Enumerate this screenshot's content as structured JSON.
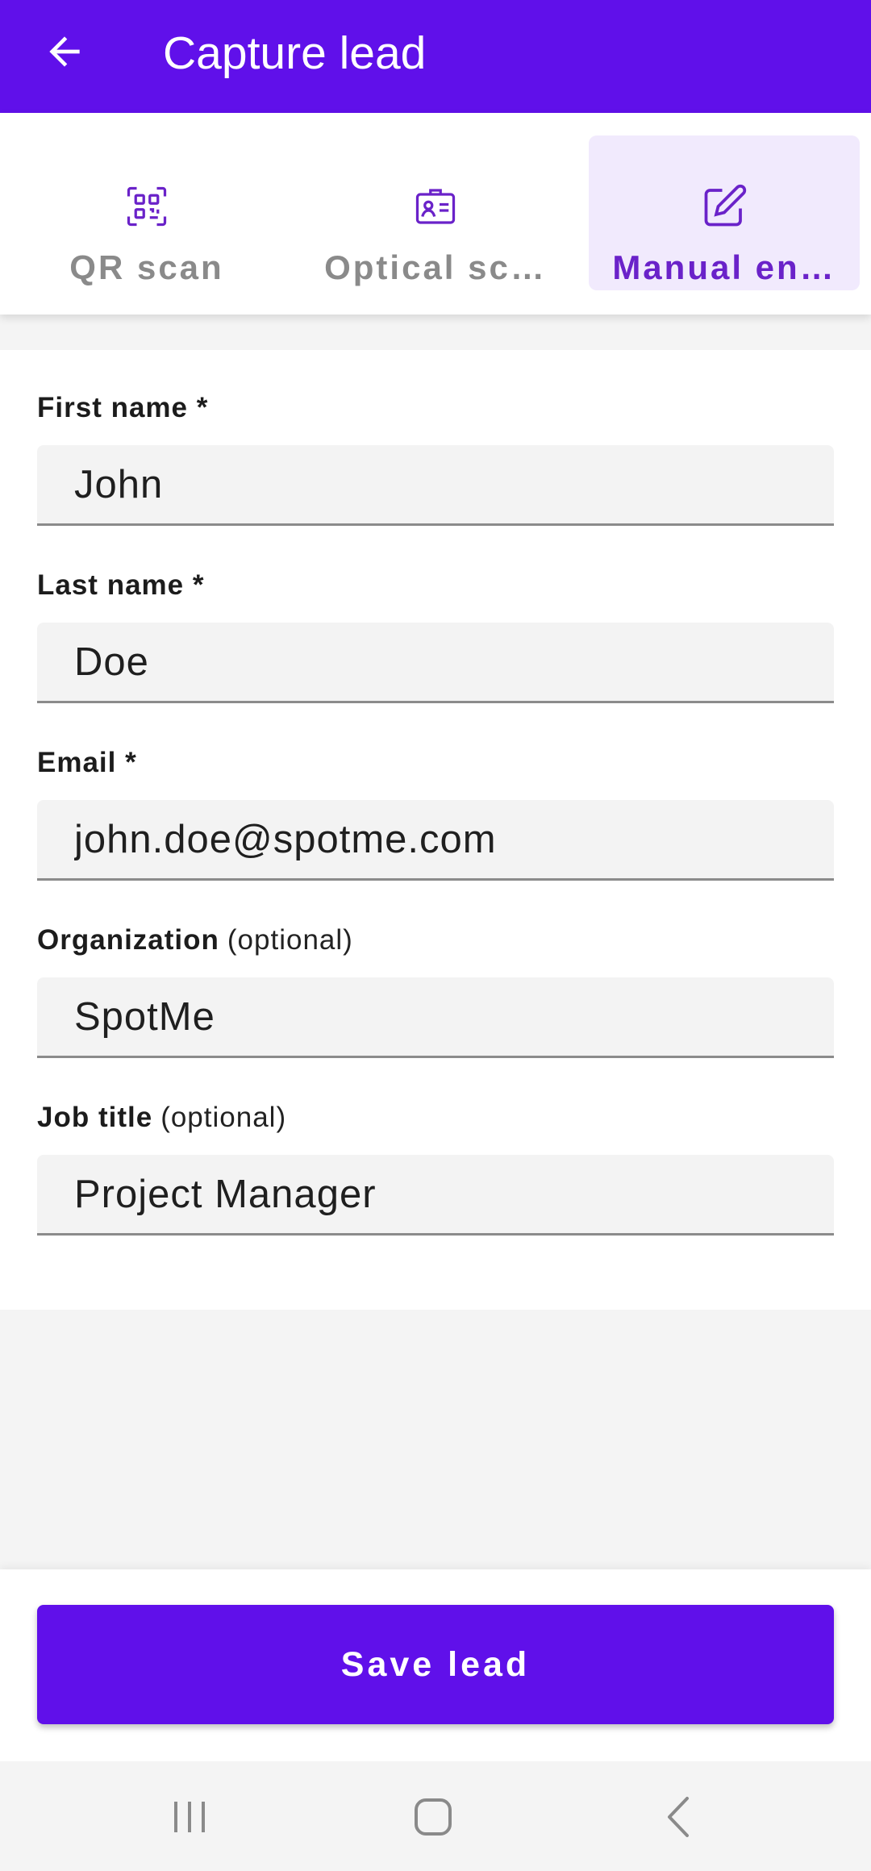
{
  "appbar": {
    "title": "Capture lead"
  },
  "tabs": [
    {
      "label": "QR scan",
      "icon": "qr-code-icon",
      "active": false
    },
    {
      "label": "Optical sc…",
      "icon": "id-badge-icon",
      "active": false
    },
    {
      "label": "Manual en…",
      "icon": "edit-icon",
      "active": true
    }
  ],
  "form": {
    "first_name": {
      "label": "First name *",
      "value": "John"
    },
    "last_name": {
      "label": "Last name *",
      "value": "Doe"
    },
    "email": {
      "label": "Email *",
      "value": "john.doe@spotme.com"
    },
    "organization": {
      "label": "Organization",
      "optional": "(optional)",
      "value": "SpotMe"
    },
    "job_title": {
      "label": "Job title",
      "optional": "(optional)",
      "value": "Project Manager"
    }
  },
  "actions": {
    "save_label": "Save lead"
  },
  "colors": {
    "primary": "#6010ea",
    "active_tab_bg": "#f1eafd",
    "active_tab_text": "#6a22c9"
  }
}
